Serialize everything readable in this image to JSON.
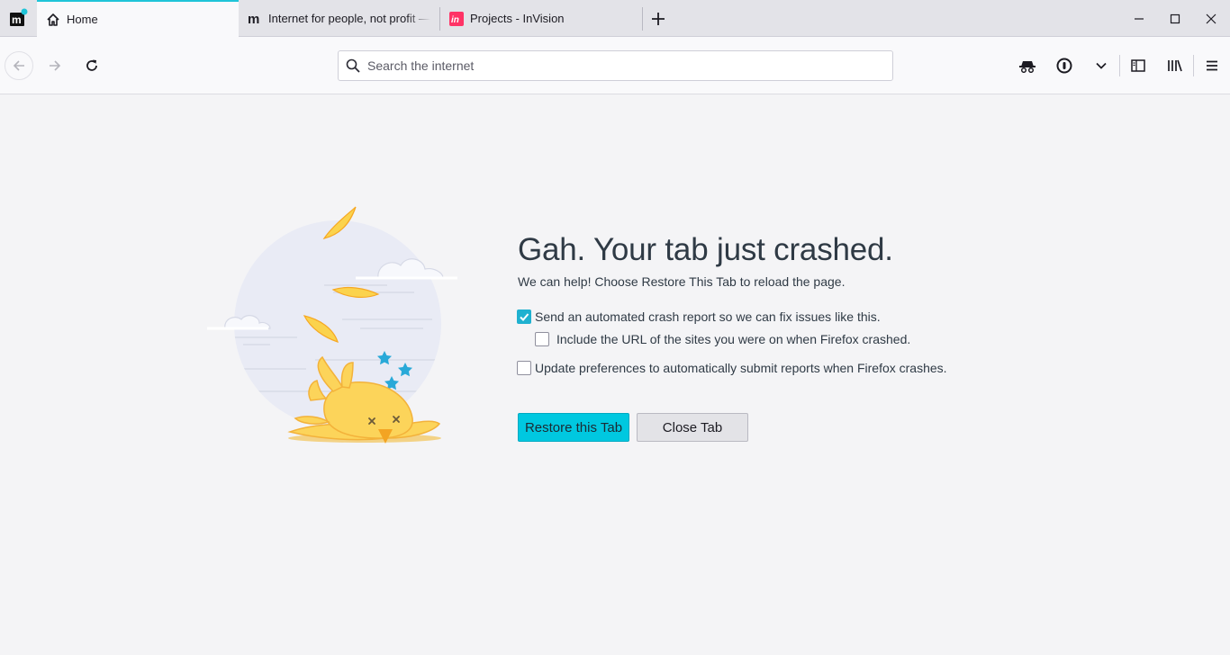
{
  "tabs": [
    {
      "title": "Home",
      "icon": "home-icon",
      "active": true
    },
    {
      "title": "Internet for people, not profit — Mozilla",
      "icon": "mozilla-m-icon",
      "active": false
    },
    {
      "title": "Projects - InVision",
      "icon": "invision-icon",
      "active": false
    }
  ],
  "toolbar": {
    "search_placeholder": "Search the internet"
  },
  "crash": {
    "title": "Gah. Your tab just crashed.",
    "subtitle": "We can help!  Choose Restore This Tab to reload the page.",
    "options": [
      {
        "label": "Send an automated crash report so we can fix issues like this.",
        "checked": true
      },
      {
        "label": "Include the URL of the sites you were on when Firefox crashed.",
        "checked": false
      },
      {
        "label": "Update preferences to automatically submit reports when Firefox crashes.",
        "checked": false
      }
    ],
    "restore_label": "Restore this Tab",
    "close_label": "Close Tab"
  },
  "colors": {
    "accent": "#00c8e0",
    "active_tab_border": "#1fc4d8",
    "checkbox_checked": "#1fb1d0"
  }
}
